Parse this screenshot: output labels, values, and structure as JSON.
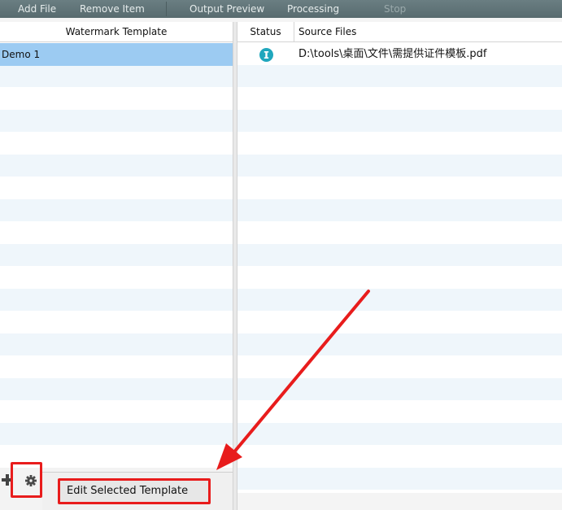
{
  "toolbar": {
    "add_file": "Add File",
    "remove_item": "Remove Item",
    "output_preview": "Output Preview",
    "processing": "Processing",
    "stop": "Stop"
  },
  "templates": {
    "header": "Watermark Template",
    "items": [
      "Demo 1"
    ]
  },
  "files": {
    "header_status": "Status",
    "header_source": "Source Files",
    "rows": [
      {
        "status_icon": "info-icon",
        "path": "D:\\tools\\桌面\\文件\\需提供证件模板.pdf"
      }
    ]
  },
  "footer": {
    "add_icon": "plus-icon",
    "settings_icon": "gear-icon"
  },
  "context_menu": {
    "edit_selected_template": "Edit Selected Template"
  },
  "colors": {
    "toolbar": "#5f7377",
    "selection": "#9ccbf2",
    "stripe": "#eff6fb",
    "status_icon": "#20a7bd",
    "annotation": "#e81c1c"
  }
}
